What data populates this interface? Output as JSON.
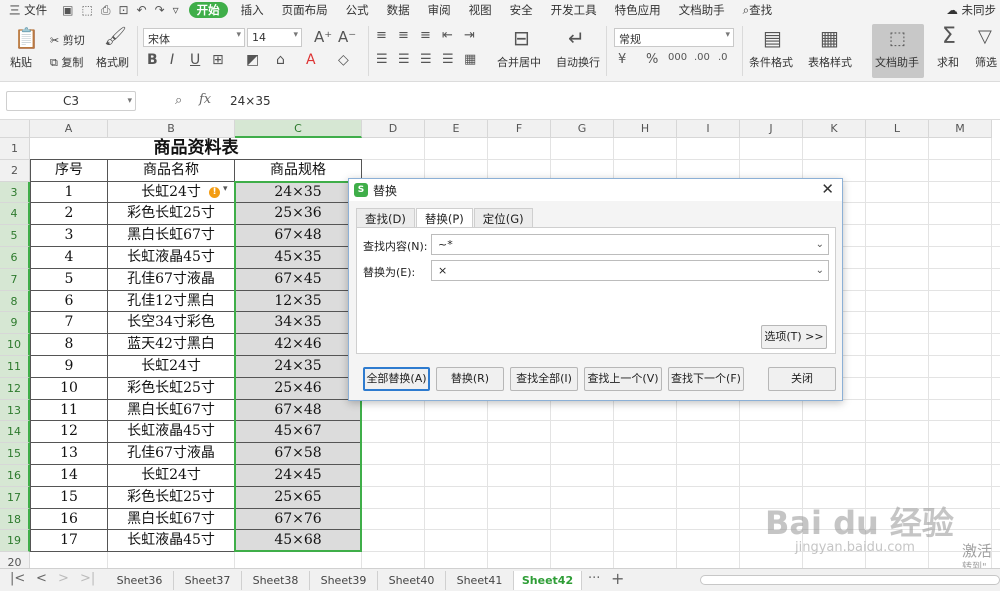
{
  "menubar": {
    "file": "三 文件",
    "active_tab": "开始",
    "tabs": [
      "插入",
      "页面布局",
      "公式",
      "数据",
      "审阅",
      "视图",
      "安全",
      "开发工具",
      "特色应用",
      "文档助手"
    ],
    "search": "查找",
    "sync": "未同步"
  },
  "ribbon": {
    "paste": "粘贴",
    "cut": "剪切",
    "copy": "复制",
    "format_painter": "格式刷",
    "font_name": "宋体",
    "font_size": "14",
    "merge_center": "合并居中",
    "wrap_text": "自动换行",
    "number_format": "常规",
    "conditional_format": "条件格式",
    "table_style": "表格样式",
    "doc_helper": "文档助手",
    "sum": "求和",
    "filter": "筛选"
  },
  "formula_bar": {
    "cell_ref": "C3",
    "fx": "fx",
    "value": "24×35"
  },
  "sheet": {
    "columns": [
      "A",
      "B",
      "C",
      "D",
      "E",
      "F",
      "G",
      "H",
      "I",
      "J",
      "K",
      "L",
      "M"
    ],
    "rows": [
      "1",
      "2",
      "3",
      "4",
      "5",
      "6",
      "7",
      "8",
      "9",
      "10",
      "11",
      "12",
      "13",
      "14",
      "15",
      "16",
      "17",
      "18",
      "19",
      "20"
    ],
    "title": "商品资料表",
    "headers": [
      "序号",
      "商品名称",
      "商品规格"
    ],
    "data": [
      [
        "1",
        "长虹24寸",
        "24×35"
      ],
      [
        "2",
        "彩色长虹25寸",
        "25×36"
      ],
      [
        "3",
        "黑白长虹67寸",
        "67×48"
      ],
      [
        "4",
        "长虹液晶45寸",
        "45×35"
      ],
      [
        "5",
        "孔佳67寸液晶",
        "67×45"
      ],
      [
        "6",
        "孔佳12寸黑白",
        "12×35"
      ],
      [
        "7",
        "长空34寸彩色",
        "34×35"
      ],
      [
        "8",
        "蓝天42寸黑白",
        "42×46"
      ],
      [
        "9",
        "长虹24寸",
        "24×35"
      ],
      [
        "10",
        "彩色长虹25寸",
        "25×46"
      ],
      [
        "11",
        "黑白长虹67寸",
        "67×48"
      ],
      [
        "12",
        "长虹液晶45寸",
        "45×67"
      ],
      [
        "13",
        "孔佳67寸液晶",
        "67×58"
      ],
      [
        "14",
        "长虹24寸",
        "24×45"
      ],
      [
        "15",
        "彩色长虹25寸",
        "25×65"
      ],
      [
        "16",
        "黑白长虹67寸",
        "67×76"
      ],
      [
        "17",
        "长虹液晶45寸",
        "45×68"
      ]
    ]
  },
  "dialog": {
    "title": "替换",
    "tabs": [
      "查找(D)",
      "替换(P)",
      "定位(G)"
    ],
    "find_label": "查找内容(N):",
    "find_value": "~*",
    "replace_label": "替换为(E):",
    "replace_value": "×",
    "options": "选项(T) >>",
    "buttons": [
      "全部替换(A)",
      "替换(R)",
      "查找全部(I)",
      "查找上一个(V)",
      "查找下一个(F)",
      "关闭"
    ]
  },
  "sheet_tabs": {
    "tabs": [
      "Sheet36",
      "Sheet37",
      "Sheet38",
      "Sheet39",
      "Sheet40",
      "Sheet41",
      "Sheet42"
    ],
    "active": "Sheet42",
    "more": "···",
    "add": "+"
  },
  "watermark": {
    "text": "Bai du 经验",
    "url": "jingyan.baidu.com",
    "activate": "激活",
    "activate_sub": "转到\""
  },
  "colors": {
    "accent": "#3fae49",
    "dialog_border": "#8cb0d6",
    "selection_fill": "#dcdcdc",
    "warning": "#f39c12"
  }
}
